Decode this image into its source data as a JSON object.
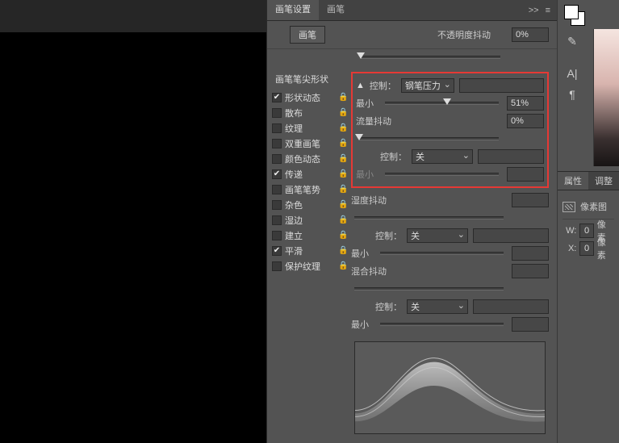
{
  "tabs": {
    "brush_settings": "画笔设置",
    "brush": "画笔",
    "expand_icon": ">>",
    "menu_icon": "≡"
  },
  "subheader": {
    "brush_button": "画笔",
    "opacity_jitter": "不透明度抖动",
    "opacity_value": "0%"
  },
  "left_list": {
    "header": "画笔笔尖形状",
    "items": [
      {
        "label": "形状动态",
        "checked": true
      },
      {
        "label": "散布",
        "checked": false
      },
      {
        "label": "纹理",
        "checked": false
      },
      {
        "label": "双重画笔",
        "checked": false
      },
      {
        "label": "颜色动态",
        "checked": false
      },
      {
        "label": "传递",
        "checked": true
      },
      {
        "label": "画笔笔势",
        "checked": false
      },
      {
        "label": "杂色",
        "checked": false
      },
      {
        "label": "湿边",
        "checked": false
      },
      {
        "label": "建立",
        "checked": false
      },
      {
        "label": "平滑",
        "checked": true
      },
      {
        "label": "保护纹理",
        "checked": false
      }
    ]
  },
  "highlighted": {
    "control_label": "控制：",
    "control_value": "钢笔压力",
    "min_label": "最小",
    "min_value": "51%",
    "flow_jitter": "流量抖动",
    "flow_value": "0%",
    "control2_label": "控制：",
    "control2_value": "关",
    "min2_label": "最小"
  },
  "sections": {
    "humidity": {
      "label": "湿度抖动",
      "value": "",
      "control_label": "控制：",
      "control_value": "关",
      "min_label": "最小"
    },
    "mix": {
      "label": "混合抖动",
      "value": "",
      "control_label": "控制：",
      "control_value": "关",
      "min_label": "最小"
    }
  },
  "right_sidebar": {
    "tool_icons": [
      "✎",
      "",
      "A|",
      "¶"
    ],
    "props_tabs": {
      "properties": "属性",
      "adjust": "调整"
    },
    "doc_label": "像素图",
    "w": {
      "label": "W:",
      "value": "0",
      "unit": "像素"
    },
    "x": {
      "label": "X:",
      "value": "0",
      "unit": "像素"
    }
  }
}
